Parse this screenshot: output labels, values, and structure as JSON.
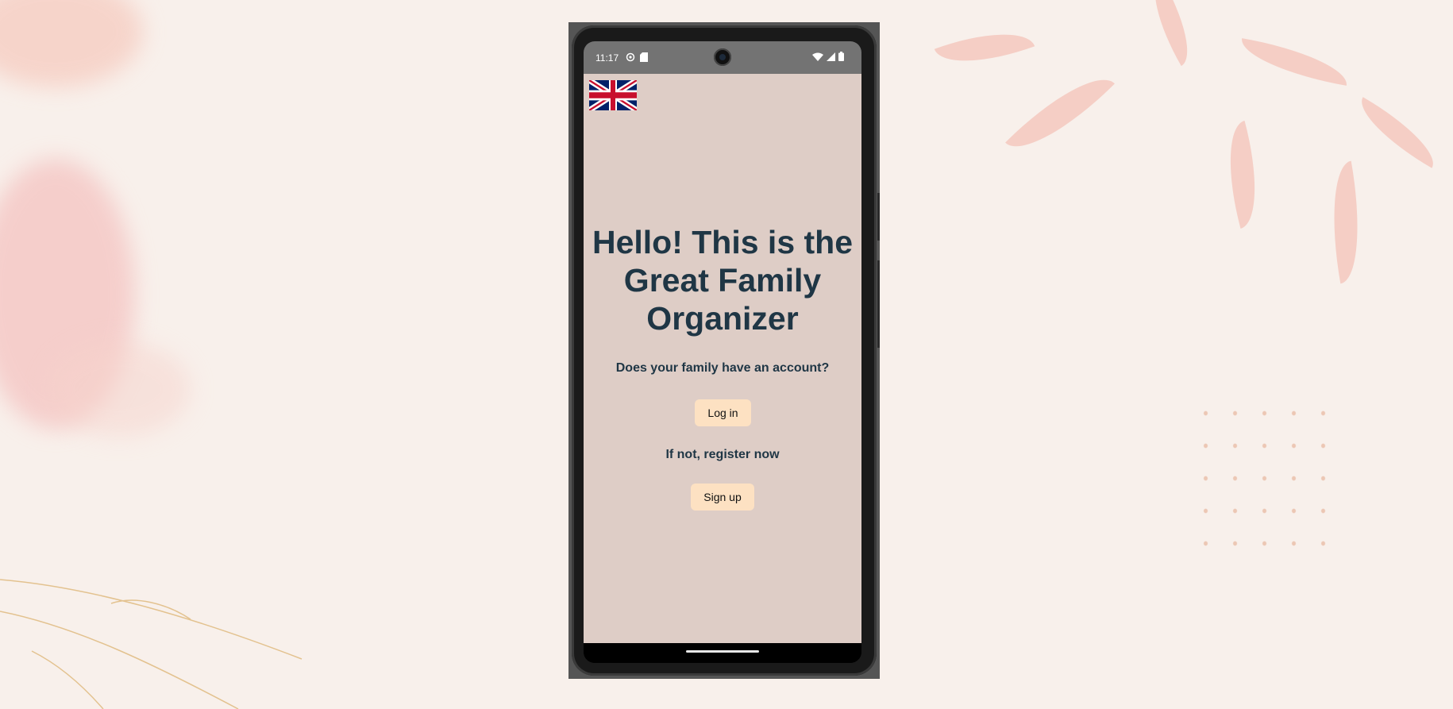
{
  "status_bar": {
    "time": "11:17",
    "left_icons": [
      "settings-icon",
      "sim-card-icon"
    ],
    "right_icons": [
      "wifi-icon",
      "signal-icon",
      "battery-icon"
    ]
  },
  "language_selector": {
    "icon": "uk-flag-icon"
  },
  "welcome": {
    "title_line1": "Hello! This is the",
    "title_line2": "Great Family",
    "title_line3": "Organizer",
    "question": "Does your family have an account?",
    "login_label": "Log in",
    "register_prompt": "If not, register now",
    "signup_label": "Sign up"
  },
  "colors": {
    "app_background": "#decdc6",
    "title_text": "#1f3645",
    "button_background": "#fde1c2",
    "status_bar": "#737373"
  }
}
